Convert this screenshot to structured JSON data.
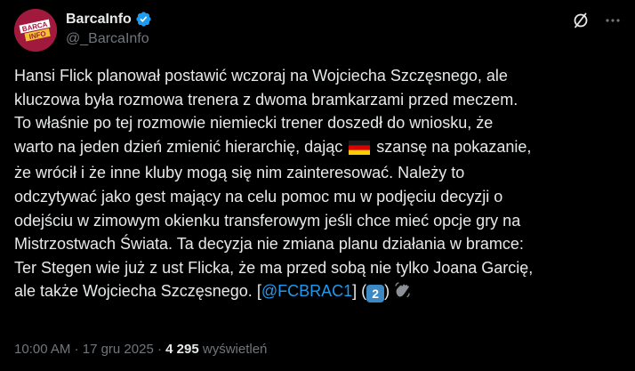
{
  "author": {
    "display_name": "BarcaInfo",
    "handle": "@_BarcaInfo",
    "avatar_text": [
      "BARCA",
      "INFO"
    ],
    "avatar_color": "#a11a3e",
    "verified": true,
    "verified_color": "#1d9bf0"
  },
  "header_icons": [
    "grok-icon",
    "more-icon"
  ],
  "tweet": {
    "lines": [
      "Hansi Flick planował postawić wczoraj na Wojciecha Szczęsnego, ale",
      "kluczowa była rozmowa trenera z dwoma bramkarzami przed meczem.",
      "To właśnie po tej rozmowie niemiecki trener doszedł do wniosku, że",
      "Mistrzostwach Świata. Ta decyzja nie zmiana planu działania w bramce:",
      "Ter Stegen wie już z ust Flicka, że ma przed sobą nie tylko Joana Garcię,"
    ],
    "line4_before_flag": "warto na jeden dzień zmienić hierarchię, dając",
    "line4_after_flag": "szansę na pokazanie,",
    "line5": "że wrócił i że inne kluby mogą się nim zainteresować. Należy to",
    "line6": "odczytywać jako gest mający na celu pomoc mu w podjęciu decyzji o",
    "line7": "odejściu w zimowym okienku transferowym jeśli chce mieć opcje gry na",
    "last_line_prefix": "ale także Wojciecha Szczęsnego. [",
    "mention": "@FCBRAC1",
    "last_line_mid": "] (",
    "badge": "2",
    "last_line_suffix": ")",
    "flag_icon": "germany-flag-icon",
    "hand_icon": "waving-hand-icon"
  },
  "meta": {
    "time": "10:00 AM",
    "sep1": "·",
    "date": "17 gru 2025",
    "sep2": "·",
    "views_count": "4 295",
    "views_label": "wyświetleń"
  },
  "colors": {
    "background": "#000000",
    "text": "#e7e9ea",
    "secondary": "#71767b",
    "link": "#1d9bf0"
  }
}
